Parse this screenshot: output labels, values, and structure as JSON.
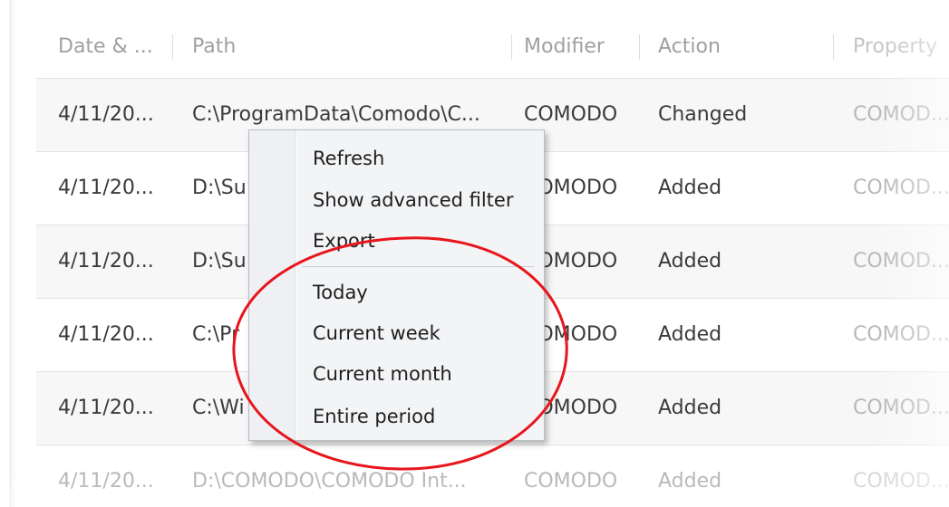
{
  "table": {
    "columns": [
      "Date & ...",
      "Path",
      "Modifier",
      "Action",
      "Property"
    ],
    "rows": [
      {
        "date": "4/11/20...",
        "path": "C:\\ProgramData\\Comodo\\C...",
        "modifier": "COMODO",
        "action": "Changed",
        "property": "COMOD..."
      },
      {
        "date": "4/11/20...",
        "path": "D:\\Su",
        "modifier": "COMODO",
        "action": "Added",
        "property": "COMOD..."
      },
      {
        "date": "4/11/20...",
        "path": "D:\\Su",
        "modifier": "COMODO",
        "action": "Added",
        "property": "COMOD..."
      },
      {
        "date": "4/11/20...",
        "path": "C:\\Pr",
        "modifier": "COMODO",
        "action": "Added",
        "property": "COMOD..."
      },
      {
        "date": "4/11/20...",
        "path": "C:\\Wi",
        "modifier": "COMODO",
        "action": "Added",
        "property": "COMOD..."
      },
      {
        "date": "4/11/20...",
        "path": "D:\\COMODO\\COMODO Int...",
        "modifier": "COMODO",
        "action": "Added",
        "property": "COMOD..."
      }
    ]
  },
  "context_menu": {
    "items": [
      "Refresh",
      "Show advanced filter",
      "Export"
    ],
    "period_items": [
      "Today",
      "Current week",
      "Current month",
      "Entire period"
    ]
  },
  "colors": {
    "annotation": "#e8151c",
    "header_text": "#a0a0a0",
    "row_alt": "#f7f7f7"
  }
}
